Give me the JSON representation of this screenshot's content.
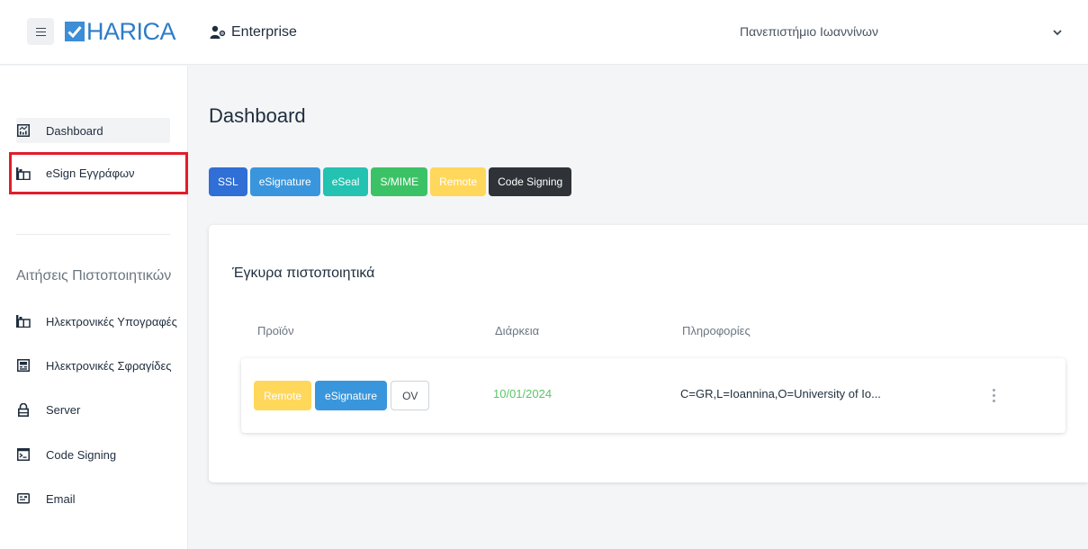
{
  "header": {
    "logo_text": "HARICA",
    "enterprise_label": "Enterprise",
    "organization": "Πανεπιστήμιο Ιωαννίνων"
  },
  "sidebar": {
    "items": [
      {
        "label": "Dashboard",
        "icon": "dashboard-icon"
      },
      {
        "label": "eSign Εγγράφων",
        "icon": "esign-icon"
      }
    ],
    "section_title": "Αιτήσεις Πιστοποιητικών",
    "requests": [
      {
        "label": "Ηλεκτρονικές Υπογραφές",
        "icon": "signature-icon"
      },
      {
        "label": "Ηλεκτρονικές Σφραγίδες",
        "icon": "seal-icon"
      },
      {
        "label": "Server",
        "icon": "lock-icon"
      },
      {
        "label": "Code Signing",
        "icon": "terminal-icon"
      },
      {
        "label": "Email",
        "icon": "email-icon"
      }
    ]
  },
  "main": {
    "title": "Dashboard",
    "filters": [
      {
        "label": "SSL",
        "color": "#2f6fd6"
      },
      {
        "label": "eSignature",
        "color": "#3996dc"
      },
      {
        "label": "eSeal",
        "color": "#23c2b1"
      },
      {
        "label": "S/MIME",
        "color": "#3cc266"
      },
      {
        "label": "Remote",
        "color": "#ffd75a"
      },
      {
        "label": "Code Signing",
        "color": "#2f3338"
      }
    ],
    "card": {
      "title": "Έγκυρα πιστοποιητικά",
      "columns": {
        "product": "Προϊόν",
        "duration": "Διάρκεια",
        "info": "Πληροφορίες"
      },
      "rows": [
        {
          "tags": [
            "Remote",
            "eSignature",
            "OV"
          ],
          "date": "10/01/2024",
          "info": "C=GR,L=Ioannina,O=University of Io..."
        }
      ]
    }
  }
}
